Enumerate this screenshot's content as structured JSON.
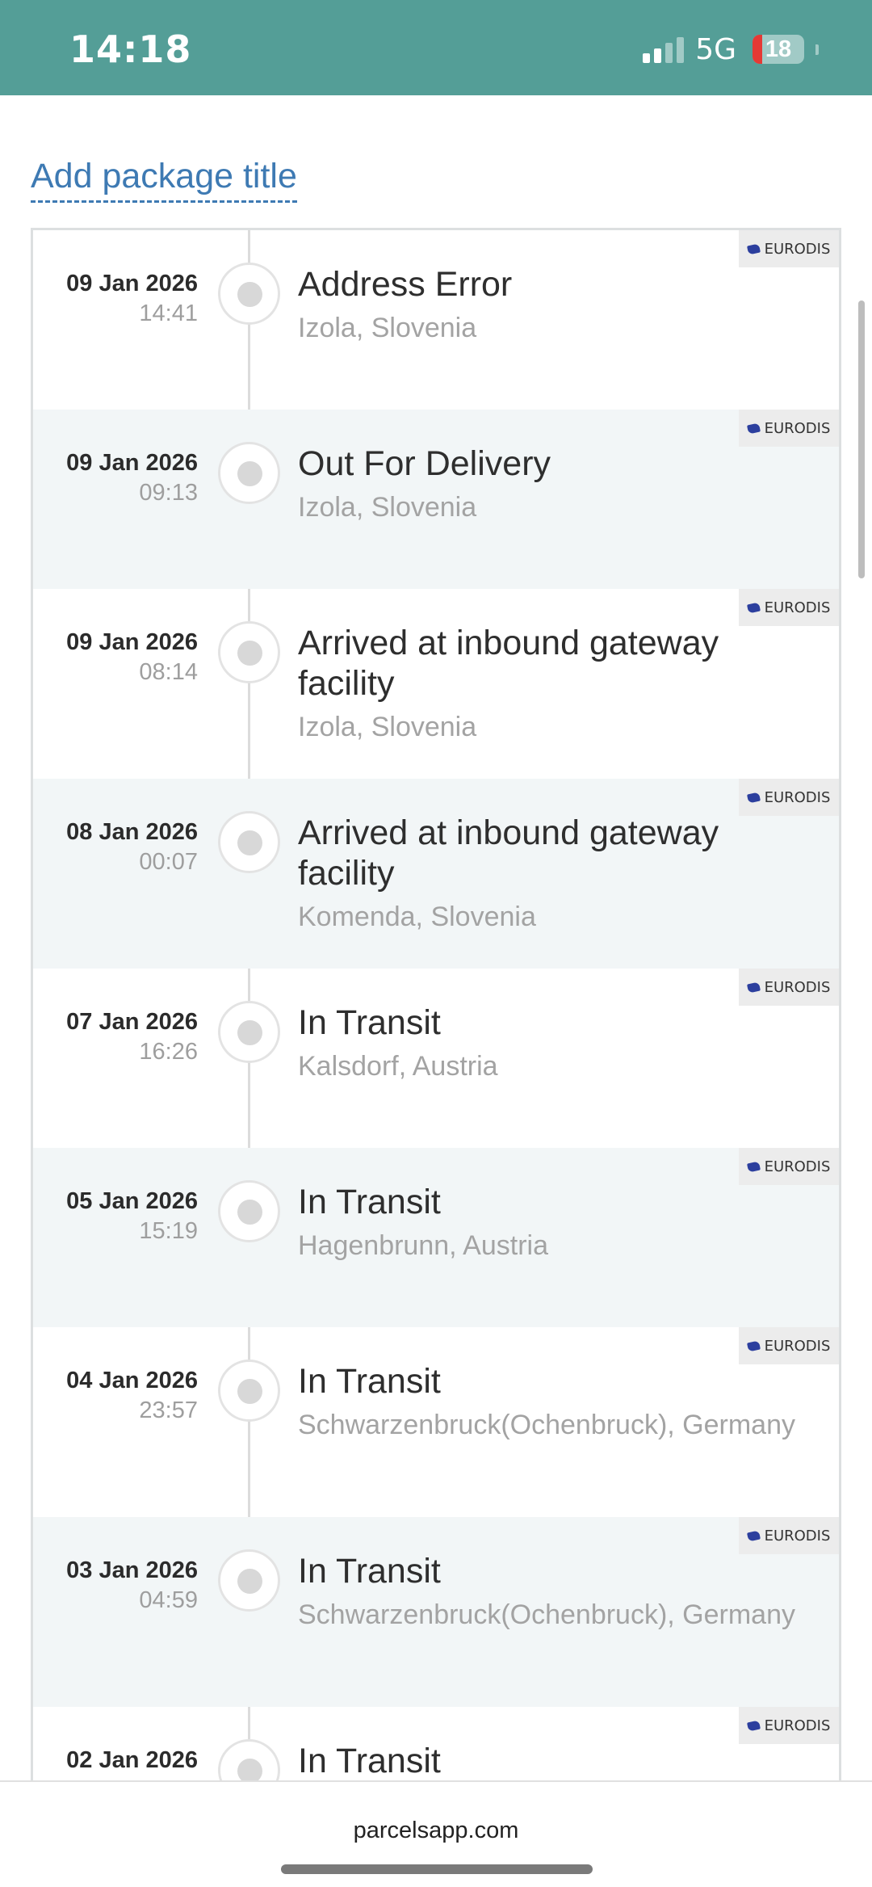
{
  "status_bar": {
    "time": "14:18",
    "network": "5G",
    "battery": "18"
  },
  "header": {
    "add_title_label": "Add package title"
  },
  "events": [
    {
      "date": "09 Jan 2026",
      "time": "14:41",
      "status": "Address Error",
      "location": "Izola, Slovenia",
      "carrier": "EURODIS"
    },
    {
      "date": "09 Jan 2026",
      "time": "09:13",
      "status": "Out For Delivery",
      "location": "Izola, Slovenia",
      "carrier": "EURODIS"
    },
    {
      "date": "09 Jan 2026",
      "time": "08:14",
      "status": "Arrived at inbound gateway facility",
      "location": "Izola, Slovenia",
      "carrier": "EURODIS"
    },
    {
      "date": "08 Jan 2026",
      "time": "00:07",
      "status": "Arrived at inbound gateway facility",
      "location": "Komenda, Slovenia",
      "carrier": "EURODIS"
    },
    {
      "date": "07 Jan 2026",
      "time": "16:26",
      "status": "In Transit",
      "location": "Kalsdorf, Austria",
      "carrier": "EURODIS"
    },
    {
      "date": "05 Jan 2026",
      "time": "15:19",
      "status": "In Transit",
      "location": "Hagenbrunn, Austria",
      "carrier": "EURODIS"
    },
    {
      "date": "04 Jan 2026",
      "time": "23:57",
      "status": "In Transit",
      "location": "Schwarzenbruck(Ochenbruck), Germany",
      "carrier": "EURODIS"
    },
    {
      "date": "03 Jan 2026",
      "time": "04:59",
      "status": "In Transit",
      "location": "Schwarzenbruck(Ochenbruck), Germany",
      "carrier": "EURODIS"
    },
    {
      "date": "02 Jan 2026",
      "time": "",
      "status": "In Transit",
      "location": "",
      "carrier": "EURODIS"
    }
  ],
  "footer": {
    "url": "parcelsapp.com"
  }
}
